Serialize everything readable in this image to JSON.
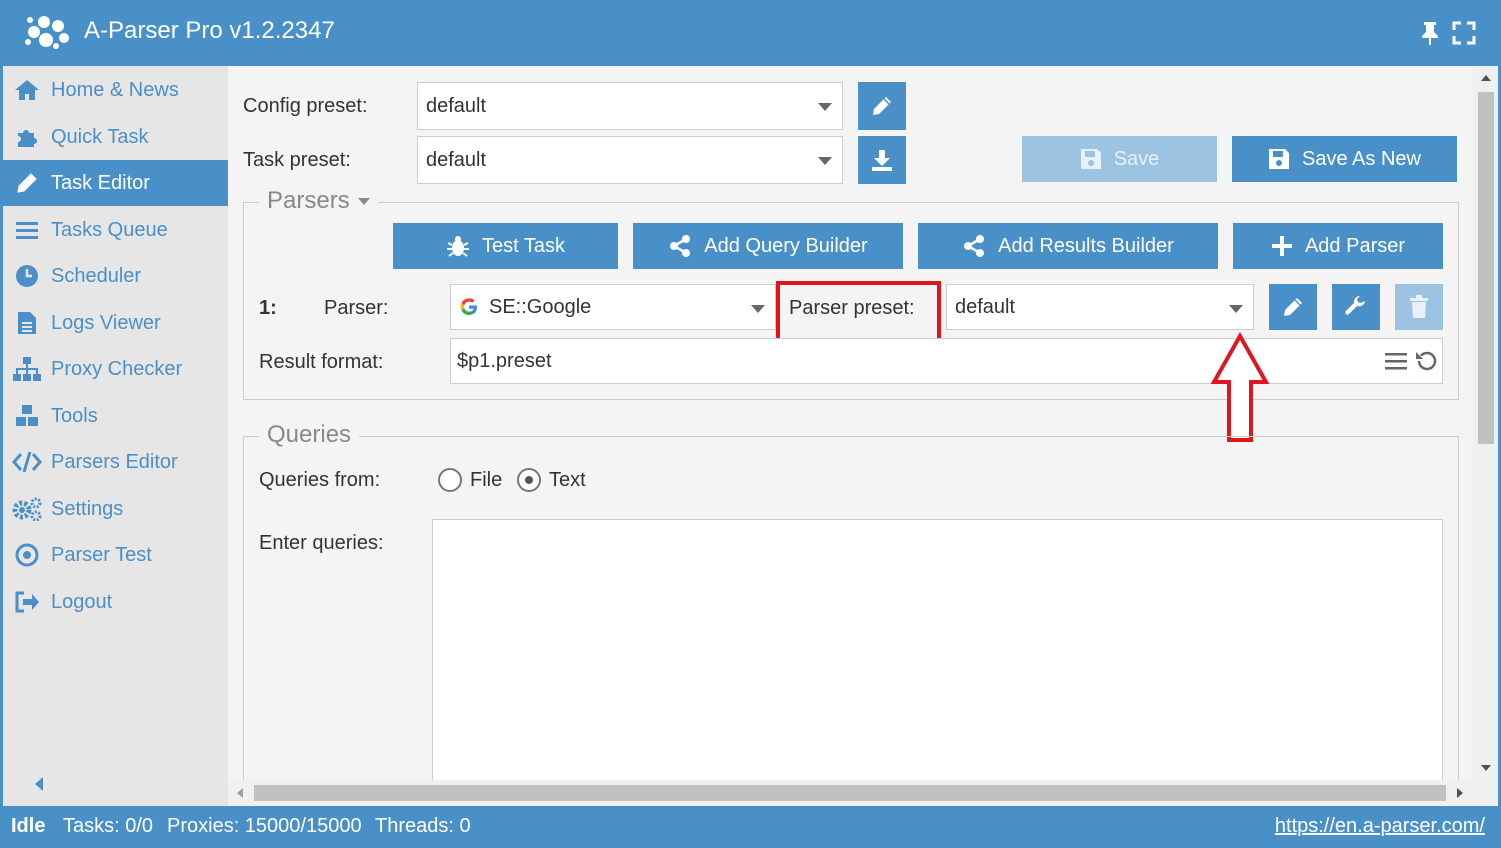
{
  "app": {
    "title": "A-Parser Pro v1.2.2347"
  },
  "sidebar": {
    "items": [
      {
        "label": "Home & News",
        "icon": "home-icon"
      },
      {
        "label": "Quick Task",
        "icon": "puzzle-icon"
      },
      {
        "label": "Task Editor",
        "icon": "pencil-icon",
        "active": true
      },
      {
        "label": "Tasks Queue",
        "icon": "list-icon"
      },
      {
        "label": "Scheduler",
        "icon": "clock-icon"
      },
      {
        "label": "Logs Viewer",
        "icon": "document-icon"
      },
      {
        "label": "Proxy Checker",
        "icon": "sitemap-icon"
      },
      {
        "label": "Tools",
        "icon": "cubes-icon"
      },
      {
        "label": "Parsers Editor",
        "icon": "code-icon"
      },
      {
        "label": "Settings",
        "icon": "cogs-icon"
      },
      {
        "label": "Parser Test",
        "icon": "target-icon"
      },
      {
        "label": "Logout",
        "icon": "sign-out-icon"
      }
    ]
  },
  "top": {
    "config_preset_label": "Config preset:",
    "config_preset_value": "default",
    "task_preset_label": "Task preset:",
    "task_preset_value": "default",
    "save_label": "Save",
    "save_as_new_label": "Save As New"
  },
  "parsers": {
    "legend": "Parsers",
    "test_task_label": "Test Task",
    "add_query_builder_label": "Add Query Builder",
    "add_results_builder_label": "Add Results Builder",
    "add_parser_label": "Add Parser",
    "row_number": "1:",
    "parser_label": "Parser:",
    "parser_value": "SE::Google",
    "parser_preset_label": "Parser preset:",
    "parser_preset_value": "default",
    "result_format_label": "Result format:",
    "result_format_value": "$p1.preset"
  },
  "queries": {
    "legend": "Queries",
    "from_label": "Queries from:",
    "option_file": "File",
    "option_text": "Text",
    "selected": "Text",
    "enter_label": "Enter queries:",
    "enter_value": ""
  },
  "status": {
    "state": "Idle",
    "tasks": "Tasks: 0/0",
    "proxies": "Proxies: 15000/15000",
    "threads": "Threads: 0",
    "link": "https://en.a-parser.com/"
  },
  "colors": {
    "primary": "#4a90c8",
    "highlight": "#e0161e",
    "disabled": "#9dc3e3"
  }
}
